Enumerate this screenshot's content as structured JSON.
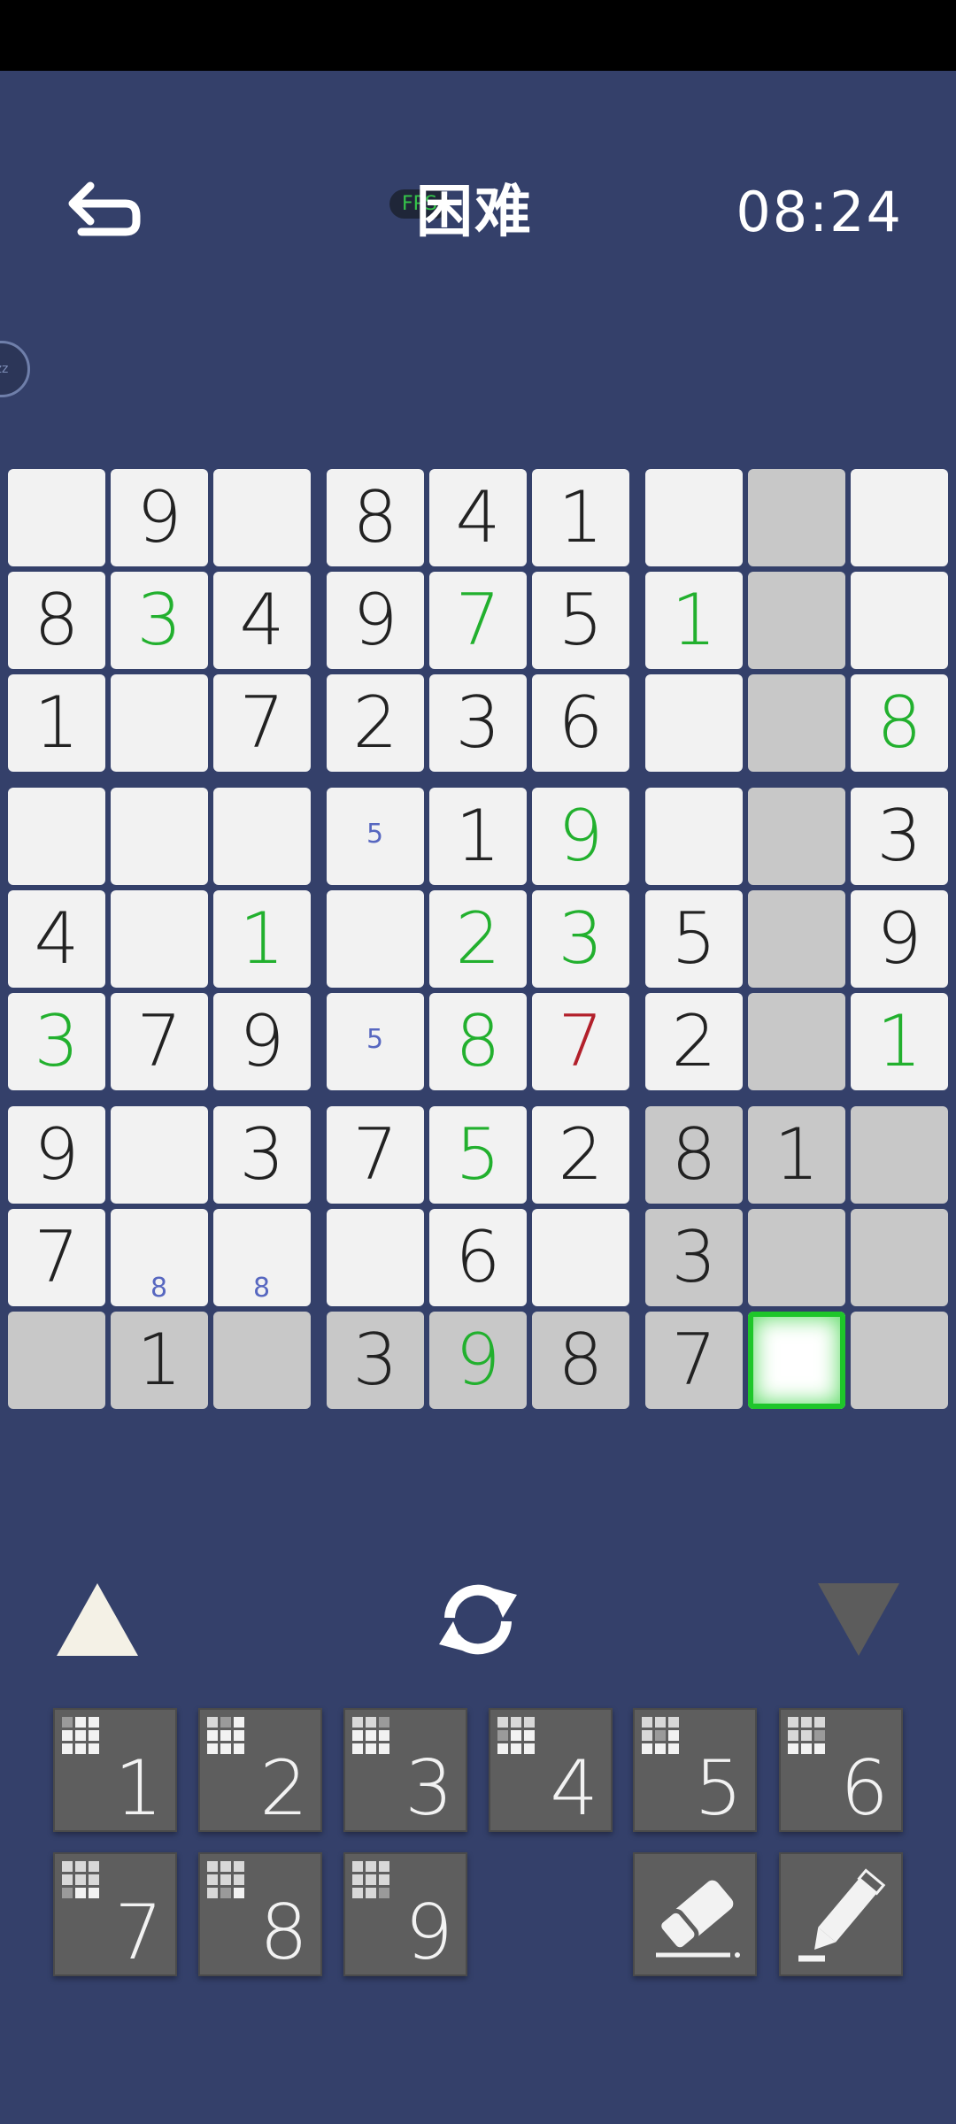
{
  "header": {
    "title": "困难",
    "timer": "08:24",
    "fps_badge": "FPS",
    "side_bubble": "zz"
  },
  "grid": [
    [
      0,
      9,
      0,
      8,
      4,
      1,
      0,
      0,
      0
    ],
    [
      8,
      3,
      4,
      9,
      7,
      5,
      1,
      0,
      0
    ],
    [
      1,
      0,
      7,
      2,
      3,
      6,
      0,
      0,
      8
    ],
    [
      0,
      0,
      0,
      0,
      1,
      9,
      0,
      0,
      3
    ],
    [
      4,
      0,
      1,
      0,
      2,
      3,
      5,
      0,
      9
    ],
    [
      3,
      7,
      9,
      0,
      8,
      7,
      2,
      0,
      1
    ],
    [
      9,
      0,
      3,
      7,
      5,
      2,
      8,
      1,
      0
    ],
    [
      7,
      0,
      0,
      0,
      6,
      0,
      3,
      0,
      0
    ],
    [
      0,
      1,
      0,
      3,
      9,
      8,
      7,
      0,
      0
    ]
  ],
  "user_entered": [
    [
      1,
      1
    ],
    [
      1,
      4
    ],
    [
      1,
      6
    ],
    [
      2,
      8
    ],
    [
      3,
      5
    ],
    [
      4,
      2
    ],
    [
      4,
      4
    ],
    [
      4,
      5
    ],
    [
      5,
      0
    ],
    [
      5,
      4
    ],
    [
      5,
      8
    ],
    [
      6,
      4
    ],
    [
      8,
      4
    ]
  ],
  "error_cells": [
    [
      5,
      5
    ]
  ],
  "highlighted_cells": [
    [
      0,
      7
    ],
    [
      1,
      7
    ],
    [
      2,
      7
    ],
    [
      3,
      7
    ],
    [
      4,
      7
    ],
    [
      5,
      7
    ],
    [
      6,
      6
    ],
    [
      6,
      7
    ],
    [
      6,
      8
    ],
    [
      7,
      6
    ],
    [
      7,
      7
    ],
    [
      7,
      8
    ],
    [
      8,
      0
    ],
    [
      8,
      1
    ],
    [
      8,
      2
    ],
    [
      8,
      3
    ],
    [
      8,
      4
    ],
    [
      8,
      5
    ],
    [
      8,
      6
    ],
    [
      8,
      8
    ]
  ],
  "selected_cell": [
    8,
    7
  ],
  "notes": [
    {
      "row": 3,
      "col": 3,
      "text": "5"
    },
    {
      "row": 5,
      "col": 3,
      "text": "5"
    },
    {
      "row": 7,
      "col": 1,
      "text": "8"
    },
    {
      "row": 7,
      "col": 2,
      "text": "8"
    }
  ],
  "numpad": [
    "1",
    "2",
    "3",
    "4",
    "5",
    "6",
    "7",
    "8",
    "9"
  ],
  "icons": {
    "back": "undo-arrow-icon",
    "up": "triangle-up-icon",
    "refresh": "refresh-icon",
    "down": "triangle-down-icon",
    "eraser": "eraser-icon",
    "pencil": "pencil-icon"
  },
  "colors": {
    "background": "#34406a",
    "cell": "#f2f2f2",
    "highlight": "#c8c8c8",
    "user_digit": "#22b02e",
    "error_digit": "#b2202b",
    "note": "#5767c0",
    "selection": "#1ec62a"
  }
}
